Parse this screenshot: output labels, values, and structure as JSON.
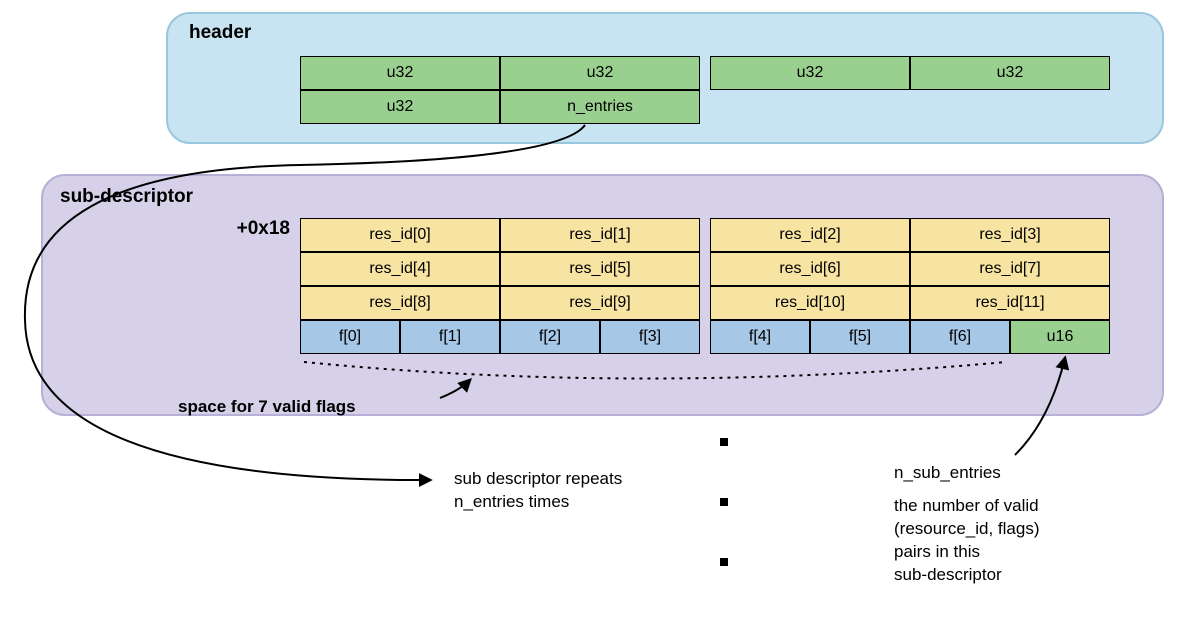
{
  "header": {
    "title": "header",
    "row1": [
      "u32",
      "u32",
      "u32",
      "u32"
    ],
    "row2": [
      "u32",
      "n_entries"
    ]
  },
  "sub": {
    "title": "sub-descriptor",
    "offset": "+0x18",
    "res_rows": [
      [
        "res_id[0]",
        "res_id[1]",
        "res_id[2]",
        "res_id[3]"
      ],
      [
        "res_id[4]",
        "res_id[5]",
        "res_id[6]",
        "res_id[7]"
      ],
      [
        "res_id[8]",
        "res_id[9]",
        "res_id[10]",
        "res_id[11]"
      ]
    ],
    "flag_row": [
      "f[0]",
      "f[1]",
      "f[2]",
      "f[3]",
      "f[4]",
      "f[5]",
      "f[6]",
      "u16"
    ]
  },
  "captions": {
    "space7": "space for 7 valid flags",
    "repeats_l1": "sub descriptor repeats",
    "repeats_l2": "n_entries times",
    "nsub_title": "n_sub_entries",
    "nsub_l1": "the number of valid",
    "nsub_l2": "(resource_id, flags)",
    "nsub_l3": "pairs in this",
    "nsub_l4": "sub-descriptor"
  }
}
